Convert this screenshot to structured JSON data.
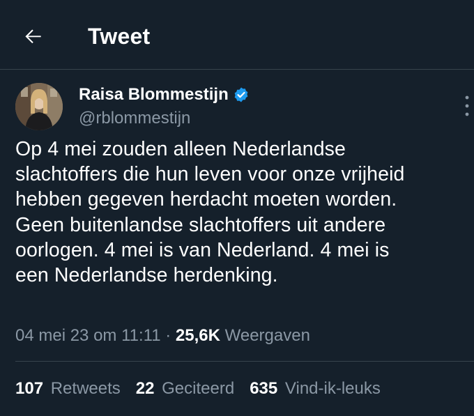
{
  "header": {
    "title": "Tweet"
  },
  "author": {
    "name": "Raisa Blommestijn",
    "handle": "@rblommestijn",
    "verified": true
  },
  "tweet": {
    "text": "Op 4 mei zouden alleen Nederlandse\nslachtoffers die hun leven voor onze vrijheid\nhebben gegeven herdacht moeten worden.\nGeen buitenlandse slachtoffers uit andere\noorlogen. 4 mei is van Nederland. 4 mei is\neen Nederlandse herdenking."
  },
  "meta": {
    "timestamp": "04 mei 23 om 11:11",
    "separator": "·",
    "views_count": "25,6K",
    "views_label": "Weergaven"
  },
  "stats": {
    "retweets_count": "107",
    "retweets_label": "Retweets",
    "quotes_count": "22",
    "quotes_label": "Geciteerd",
    "likes_count": "635",
    "likes_label": "Vind-ik-leuks"
  },
  "colors": {
    "background": "#15202b",
    "text": "#ffffff",
    "secondary_text": "#8b98a5",
    "divider": "#38444d",
    "verified_badge": "#1d9bf0"
  },
  "icons": {
    "back": "arrow-left-icon",
    "verified": "verified-badge-icon",
    "more": "more-vertical-icon"
  }
}
